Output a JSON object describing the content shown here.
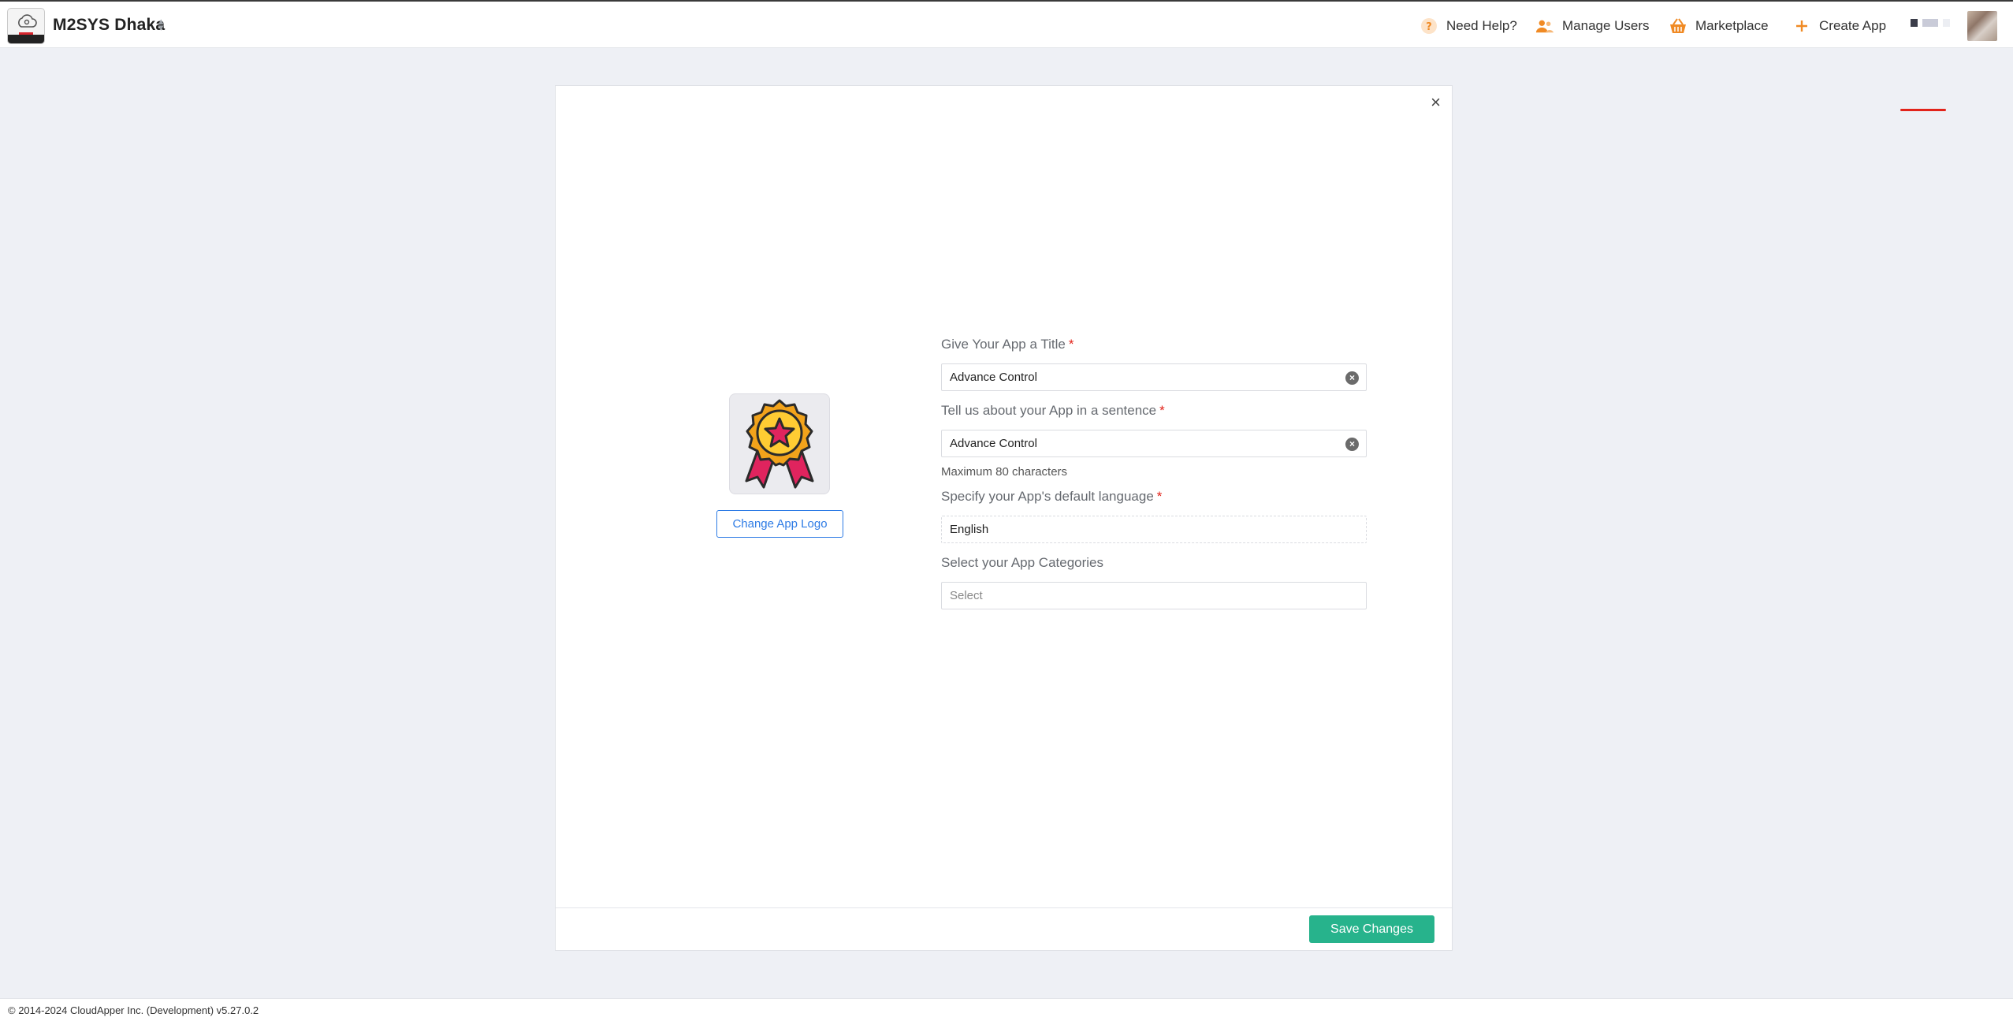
{
  "header": {
    "org_name": "M2SYS Dhaka",
    "nav": {
      "help": "Need Help?",
      "manage_users": "Manage Users",
      "marketplace": "Marketplace",
      "create_app": "Create App"
    },
    "icons": {
      "help": "question-circle-icon",
      "users": "users-icon",
      "marketplace": "basket-icon",
      "create": "plus-icon"
    },
    "accent": "#f08a24"
  },
  "modal": {
    "close_glyph": "×",
    "change_logo_label": "Change App Logo",
    "fields": {
      "title": {
        "label": "Give Your App a Title",
        "required_mark": "*",
        "value": "Advance Control"
      },
      "description": {
        "label": "Tell us about your App in a sentence",
        "required_mark": "*",
        "value": "Advance Control",
        "hint": "Maximum 80 characters"
      },
      "language": {
        "label": "Specify your App's default language",
        "required_mark": "*",
        "value": "English"
      },
      "categories": {
        "label": "Select your App Categories",
        "placeholder": "Select"
      }
    },
    "save_label": "Save Changes",
    "save_color": "#27b38c"
  },
  "footer": {
    "copyright": "© 2014-2024 CloudApper Inc. (Development) v5.27.0.2"
  }
}
